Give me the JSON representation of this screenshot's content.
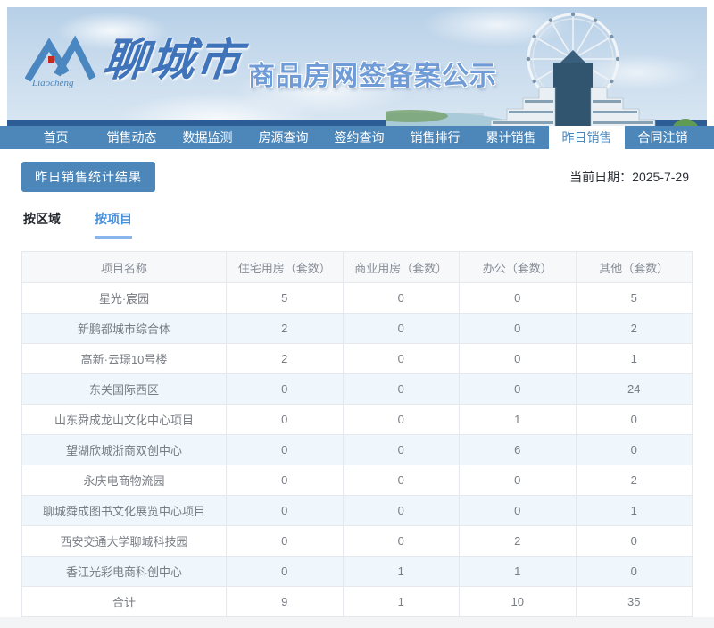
{
  "banner": {
    "logo_text": "Liaocheng",
    "city_name": "聊城市",
    "site_title": "商品房网签备案公示"
  },
  "nav": {
    "items": [
      {
        "label": "首页",
        "active": false
      },
      {
        "label": "销售动态",
        "active": false
      },
      {
        "label": "数据监测",
        "active": false
      },
      {
        "label": "房源查询",
        "active": false
      },
      {
        "label": "签约查询",
        "active": false
      },
      {
        "label": "销售排行",
        "active": false
      },
      {
        "label": "累计销售",
        "active": false
      },
      {
        "label": "昨日销售",
        "active": true
      },
      {
        "label": "合同注销",
        "active": false
      }
    ]
  },
  "toolbar": {
    "section_button_label": "昨日销售统计结果",
    "date_label": "当前日期：",
    "date_value": "2025-7-29"
  },
  "subtabs": [
    {
      "label": "按区域",
      "active": false
    },
    {
      "label": "按项目",
      "active": true
    }
  ],
  "table": {
    "columns": [
      "项目名称",
      "住宅用房（套数）",
      "商业用房（套数）",
      "办公（套数）",
      "其他（套数）"
    ],
    "rows": [
      {
        "name": "星光·宸园",
        "values": [
          "5",
          "0",
          "0",
          "5"
        ]
      },
      {
        "name": "新鹏都城市综合体",
        "values": [
          "2",
          "0",
          "0",
          "2"
        ]
      },
      {
        "name": "高新·云璟10号楼",
        "values": [
          "2",
          "0",
          "0",
          "1"
        ]
      },
      {
        "name": "东关国际西区",
        "values": [
          "0",
          "0",
          "0",
          "24"
        ]
      },
      {
        "name": "山东舜成龙山文化中心项目",
        "values": [
          "0",
          "0",
          "1",
          "0"
        ]
      },
      {
        "name": "望湖欣城浙商双创中心",
        "values": [
          "0",
          "0",
          "6",
          "0"
        ]
      },
      {
        "name": "永庆电商物流园",
        "values": [
          "0",
          "0",
          "0",
          "2"
        ]
      },
      {
        "name": "聊城舜成图书文化展览中心项目",
        "values": [
          "0",
          "0",
          "0",
          "1"
        ]
      },
      {
        "name": "西安交通大学聊城科技园",
        "values": [
          "0",
          "0",
          "2",
          "0"
        ]
      },
      {
        "name": "香江光彩电商科创中心",
        "values": [
          "0",
          "1",
          "1",
          "0"
        ]
      }
    ],
    "total_row": {
      "name": "合计",
      "values": [
        "9",
        "1",
        "10",
        "35"
      ]
    }
  },
  "colors": {
    "nav_blue": "#4d86b8",
    "active_tab_text": "#4d86b8",
    "subtab_active": "#4a90d9",
    "row_alt": "#eff7fc",
    "banner_dark_bar": "#2c5d95",
    "title_blue": "#6f9bd6",
    "logo_red": "#c32a20"
  }
}
